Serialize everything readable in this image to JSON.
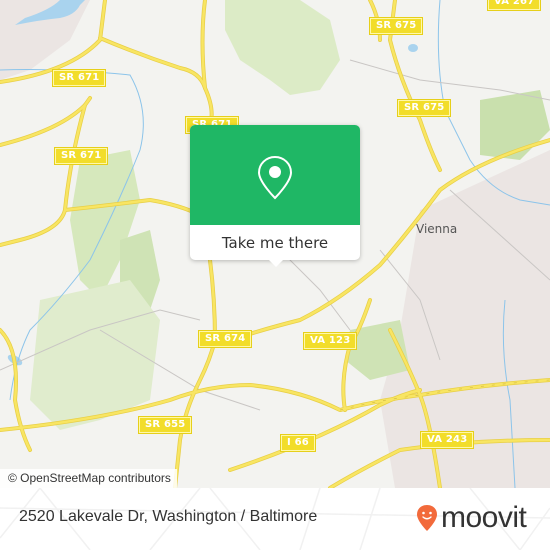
{
  "map": {
    "road_labels": [
      {
        "id": "sr671-a",
        "text": "SR 671"
      },
      {
        "id": "sr671-b",
        "text": "SR 671"
      },
      {
        "id": "sr671-c",
        "text": "SR 671"
      },
      {
        "id": "sr675-a",
        "text": "SR 675"
      },
      {
        "id": "sr675-b",
        "text": "SR 675"
      },
      {
        "id": "va267",
        "text": "VA 267"
      },
      {
        "id": "sr674",
        "text": "SR 674"
      },
      {
        "id": "va123",
        "text": "VA 123"
      },
      {
        "id": "sr655",
        "text": "SR 655"
      },
      {
        "id": "i66",
        "text": "I 66"
      },
      {
        "id": "va243",
        "text": "VA 243"
      }
    ],
    "place_labels": [
      {
        "id": "vienna",
        "text": "Vienna"
      }
    ],
    "attribution": "© OpenStreetMap contributors",
    "colors": {
      "land": "#f3f3f0",
      "park": "#d9eac0",
      "road": "#f6e05c",
      "water": "#a9d3ee",
      "urban": "#ebe5e3",
      "shield": "#f2dd2a"
    }
  },
  "popup": {
    "icon": "map-pin-icon",
    "button_label": "Take me there",
    "color": "#1fb765"
  },
  "footer": {
    "address": "2520 Lakevale Dr, Washington / Baltimore",
    "logo_text": "moovit",
    "logo_icon": "moovit-smiley-pin-icon",
    "logo_color": "#f26a3b"
  }
}
